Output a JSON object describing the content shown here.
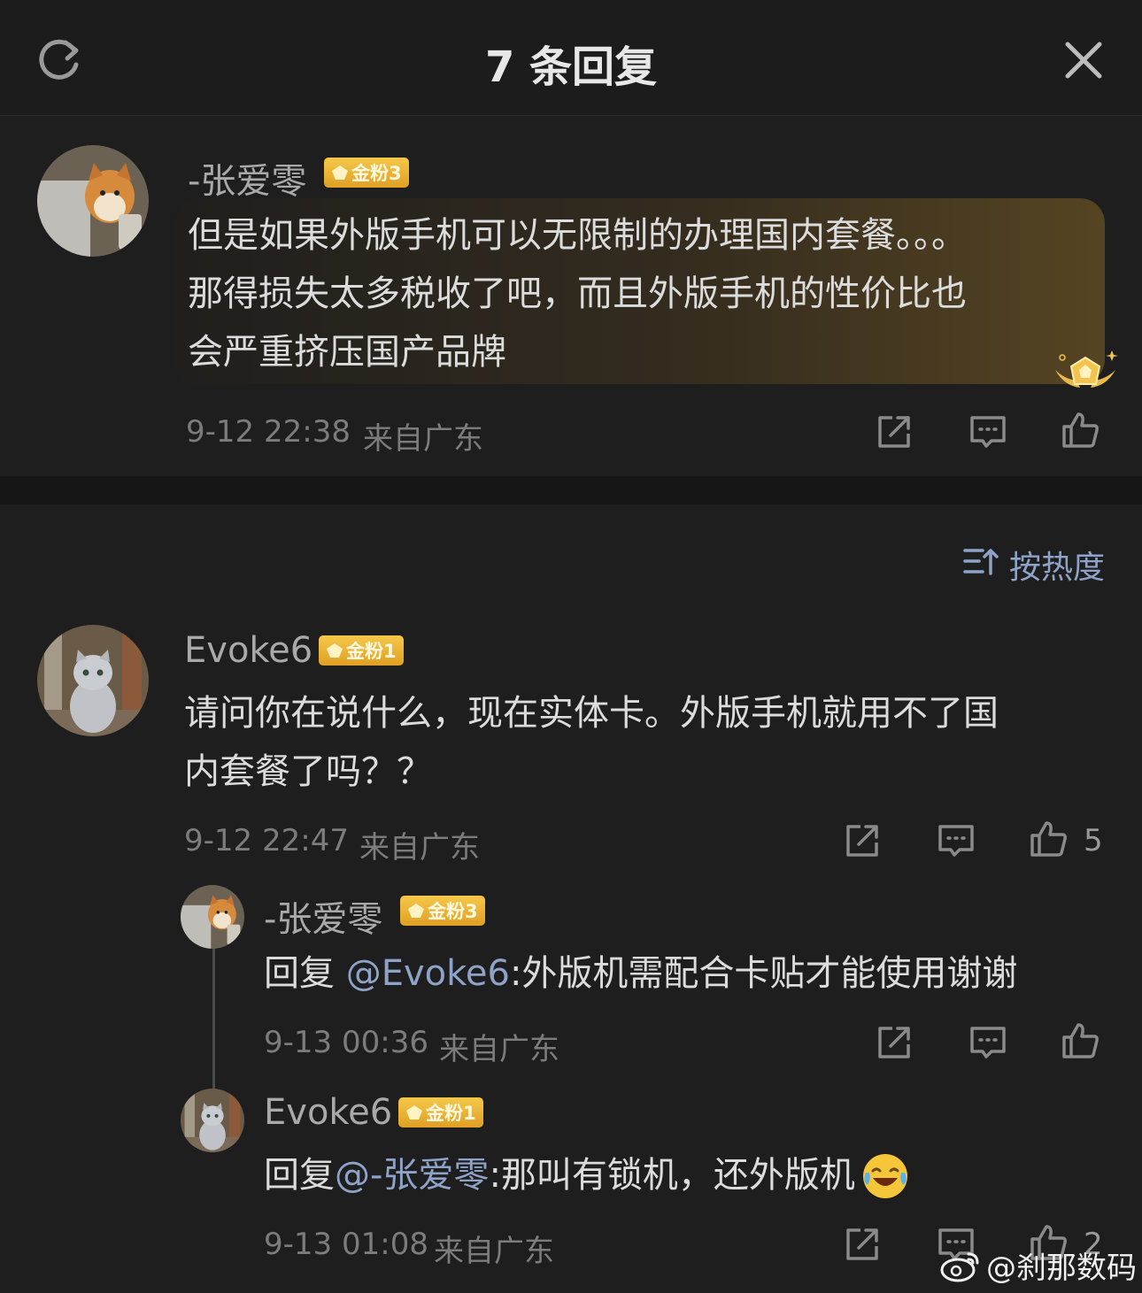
{
  "header": {
    "title": "7 条回复",
    "refresh_icon": "refresh-icon",
    "close_icon": "close-icon"
  },
  "root_comment": {
    "username": "-张爱零",
    "badge": "金粉3",
    "text": "但是如果外版手机可以无限制的办理国内套餐。。。那得损失太多税收了吧，而且外版手机的性价比也会严重挤压国产品牌",
    "line1": "但是如果外版手机可以无限制的办理国内套餐。。。",
    "line2": "那得损失太多税收了吧，而且外版手机的性价比也",
    "line3": "会严重挤压国产品牌",
    "time": "9-12 22:38",
    "location": "来自广东",
    "actions": [
      "share-icon",
      "comment-icon",
      "like-icon"
    ]
  },
  "sort": {
    "label": "按热度",
    "icon": "sort-icon"
  },
  "comments": [
    {
      "username": "Evoke6",
      "badge": "金粉1",
      "line1": "请问你在说什么，现在实体卡。外版手机就用不了国",
      "line2": "内套餐了吗？？",
      "time": "9-12 22:47",
      "location": "来自广东",
      "likes": "5"
    }
  ],
  "replies": [
    {
      "username": "-张爱零",
      "badge": "金粉3",
      "prefix": "回复 ",
      "mention": "@Evoke6",
      "text": ":外版机需配合卡贴才能使用谢谢",
      "time": "9-13 00:36",
      "location": "来自广东"
    },
    {
      "username": "Evoke6",
      "badge": "金粉1",
      "prefix": "回复 ",
      "mention": "@-张爱零",
      "text": ":那叫有锁机，还外版机",
      "emoji": "laugh-cry-emoji",
      "time": "9-13 01:08",
      "location": "来自广东",
      "likes": "2"
    }
  ],
  "watermark": {
    "text": "@刹那数码",
    "icon": "weibo-icon"
  },
  "colors": {
    "background": "#1e1e1e",
    "badge_gold": "#f0b530",
    "mention_blue": "#8ea3c7",
    "meta_gray": "#7c7c7c"
  }
}
